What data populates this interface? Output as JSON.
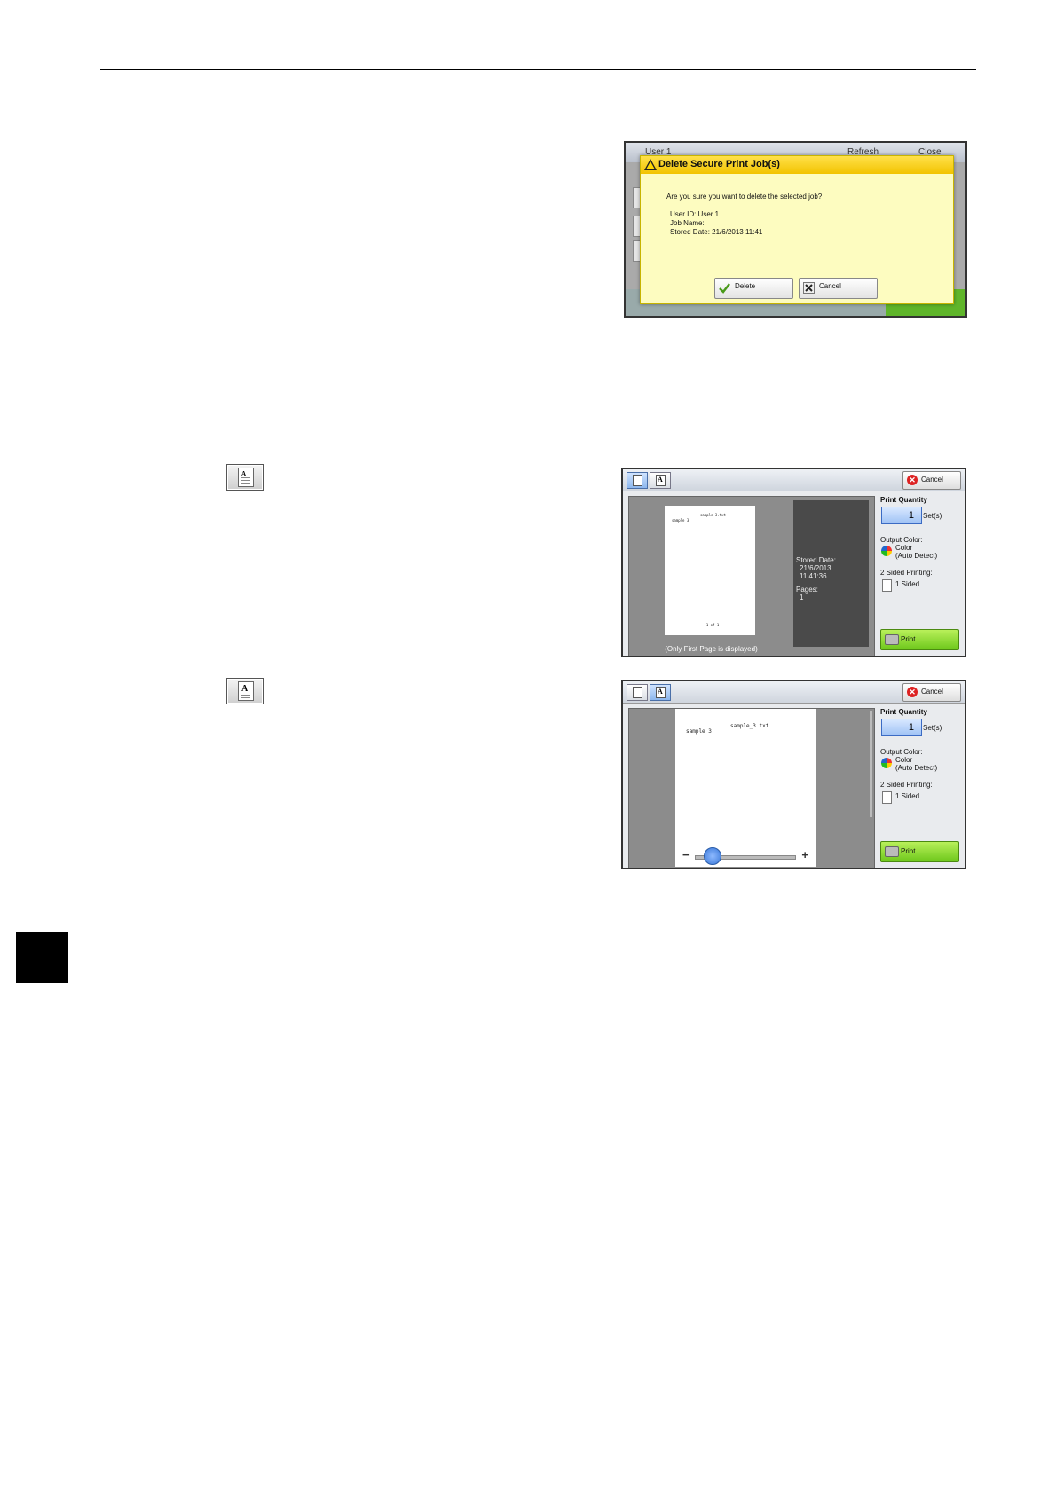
{
  "dialog_shot": {
    "bg_title": "User 1",
    "bg_refresh": "Refresh",
    "bg_close": "Close",
    "title": "Delete Secure Print Job(s)",
    "question": "Are you sure you want to delete the selected job?",
    "user_id": "User ID: User 1",
    "job_name": "Job Name:",
    "stored_date": "Stored Date: 21/6/2013 11:41",
    "delete_label": "Delete",
    "cancel_label": "Cancel"
  },
  "preview_list": {
    "cancel_label": "Cancel",
    "page_header": "sample 3.txt",
    "page_text": "sample 3",
    "page_footer": "- 1 of 1 -",
    "stored_date_label": "Stored Date:",
    "stored_date": "21/6/2013",
    "stored_time": "11:41:36",
    "pages_label": "Pages:",
    "pages": "1",
    "only_first": "(Only First Page is displayed)",
    "print_quantity_label": "Print Quantity",
    "quantity": "1",
    "sets_label": "Set(s)",
    "output_color_label": "Output Color:",
    "color_value": "Color",
    "color_detect": "(Auto Detect)",
    "two_sided_label": "2 Sided Printing:",
    "sided_value": "1 Sided",
    "print_label": "Print"
  },
  "preview_zoom": {
    "cancel_label": "Cancel",
    "page_header": "sample_3.txt",
    "page_text": "sample 3",
    "print_quantity_label": "Print Quantity",
    "quantity": "1",
    "sets_label": "Set(s)",
    "output_color_label": "Output Color:",
    "color_value": "Color",
    "color_detect": "(Auto Detect)",
    "two_sided_label": "2 Sided Printing:",
    "sided_value": "1 Sided",
    "print_label": "Print",
    "zoom_level": 0.1
  }
}
